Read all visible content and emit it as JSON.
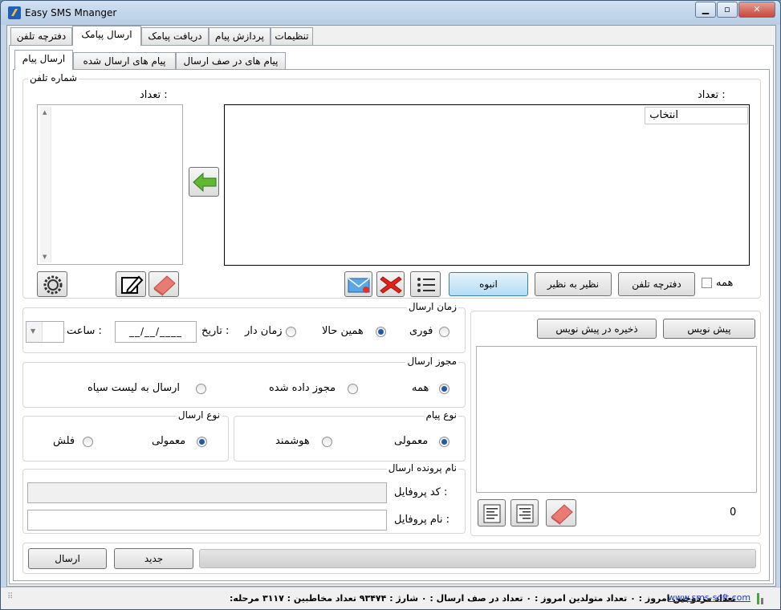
{
  "window": {
    "title": "Easy SMS Mnanger",
    "controls": {
      "minimize": "▁",
      "maximize": "▫",
      "close": "✕"
    }
  },
  "main_tabs": [
    {
      "label": "دفترچه تلفن"
    },
    {
      "label": "ارسال پیامک"
    },
    {
      "label": "دریافت پیامک"
    },
    {
      "label": "پردازش پیام"
    },
    {
      "label": "تنظیمات"
    }
  ],
  "sub_tabs": [
    {
      "label": "ارسال پیام"
    },
    {
      "label": "پیام های ارسال شده"
    },
    {
      "label": "پیام های در صف ارسال"
    }
  ],
  "phone_group": {
    "title": "شماره تلفن",
    "count_label_left": "تعداد :",
    "count_label_right": "تعداد :",
    "grid_header": "انتخاب",
    "all_checkbox_label": "همه",
    "phonebook_button": "دفترچه تلفن",
    "peer_button": "نظیر به نظیر",
    "bulk_button": "انبوه"
  },
  "send_time": {
    "title": "زمان ارسال",
    "option_instant": "فوری",
    "option_now": "همین حالا",
    "option_scheduled": "زمان دار",
    "date_label": "تاریخ :",
    "date_value": "__/__/____",
    "time_label": "ساعت :"
  },
  "send_permit": {
    "title": "مجوز ارسال",
    "option_all": "همه",
    "option_permitted": "مجوز داده شده",
    "option_blacklist": "ارسال به لیست سیاه"
  },
  "message_type": {
    "title": "نوع پیام",
    "option_normal": "معمولی",
    "option_smart": "هوشمند"
  },
  "send_type": {
    "title": "نوع ارسال",
    "option_normal": "معمولی",
    "option_flash": "فلش"
  },
  "profile": {
    "title": "نام پرونده ارسال",
    "code_label": "کد پروفایل :",
    "name_label": "نام پروفایل :"
  },
  "draft": {
    "draft_button": "پیش نویس",
    "save_draft_button": "ذخیره در پیش نویس",
    "char_count": "0"
  },
  "bottom": {
    "send_button": "ارسال",
    "new_button": "جدید"
  },
  "status": {
    "link": "www.sms-soft.com",
    "text": "تعداد مزدوجین امروز : ۰   تعداد متولدین امروز : ۰   تعداد در صف ارسال : ۰   شارژ : ۹۳۴۷۴   تعداد مخاطبین : ۳۱۱۷   مرحله:"
  },
  "colors": {
    "accent": "#1e5aa7",
    "window_frame": "#c4d6e8",
    "close": "#c7463a"
  }
}
